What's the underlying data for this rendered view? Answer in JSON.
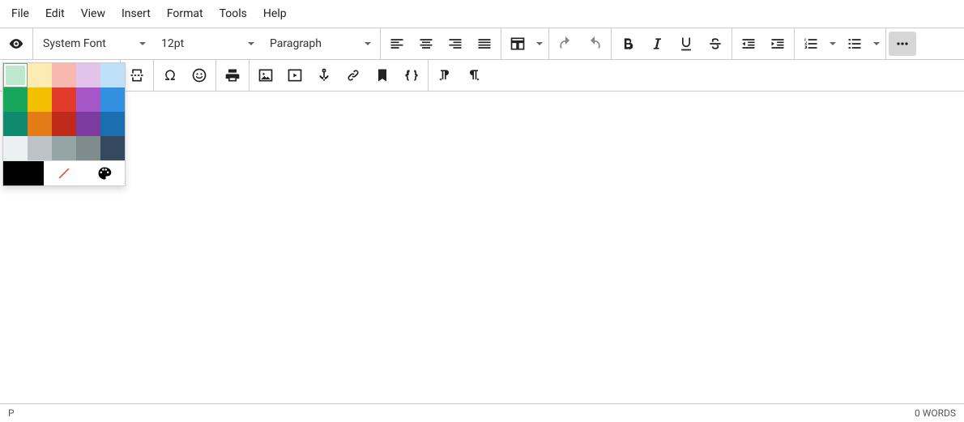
{
  "menubar": [
    "File",
    "Edit",
    "View",
    "Insert",
    "Format",
    "Tools",
    "Help"
  ],
  "toolbar1": {
    "font": "System Font",
    "size": "12pt",
    "block": "Paragraph"
  },
  "status": {
    "path": "P",
    "words": "0 WORDS"
  },
  "text_color_bar": "#c0392b",
  "highlight_color_bar": "#f1c40f",
  "color_picker": {
    "row1": [
      "#BEE8CD",
      "#FCECB3",
      "#F6B8AF",
      "#E2C4EA",
      "#BDE0F8"
    ],
    "row2": [
      "#18A65C",
      "#F3C000",
      "#E23B2B",
      "#A556C7",
      "#338FE0"
    ],
    "row3": [
      "#0F8A6E",
      "#E37C17",
      "#BF2A1B",
      "#7C3B9E",
      "#1B6FB0"
    ],
    "row4": [
      "#ECF0F1",
      "#BDC3C7",
      "#95A5A6",
      "#7F8C8D",
      "#34495E"
    ],
    "row5_black": "#000000",
    "selected_index": 0
  }
}
